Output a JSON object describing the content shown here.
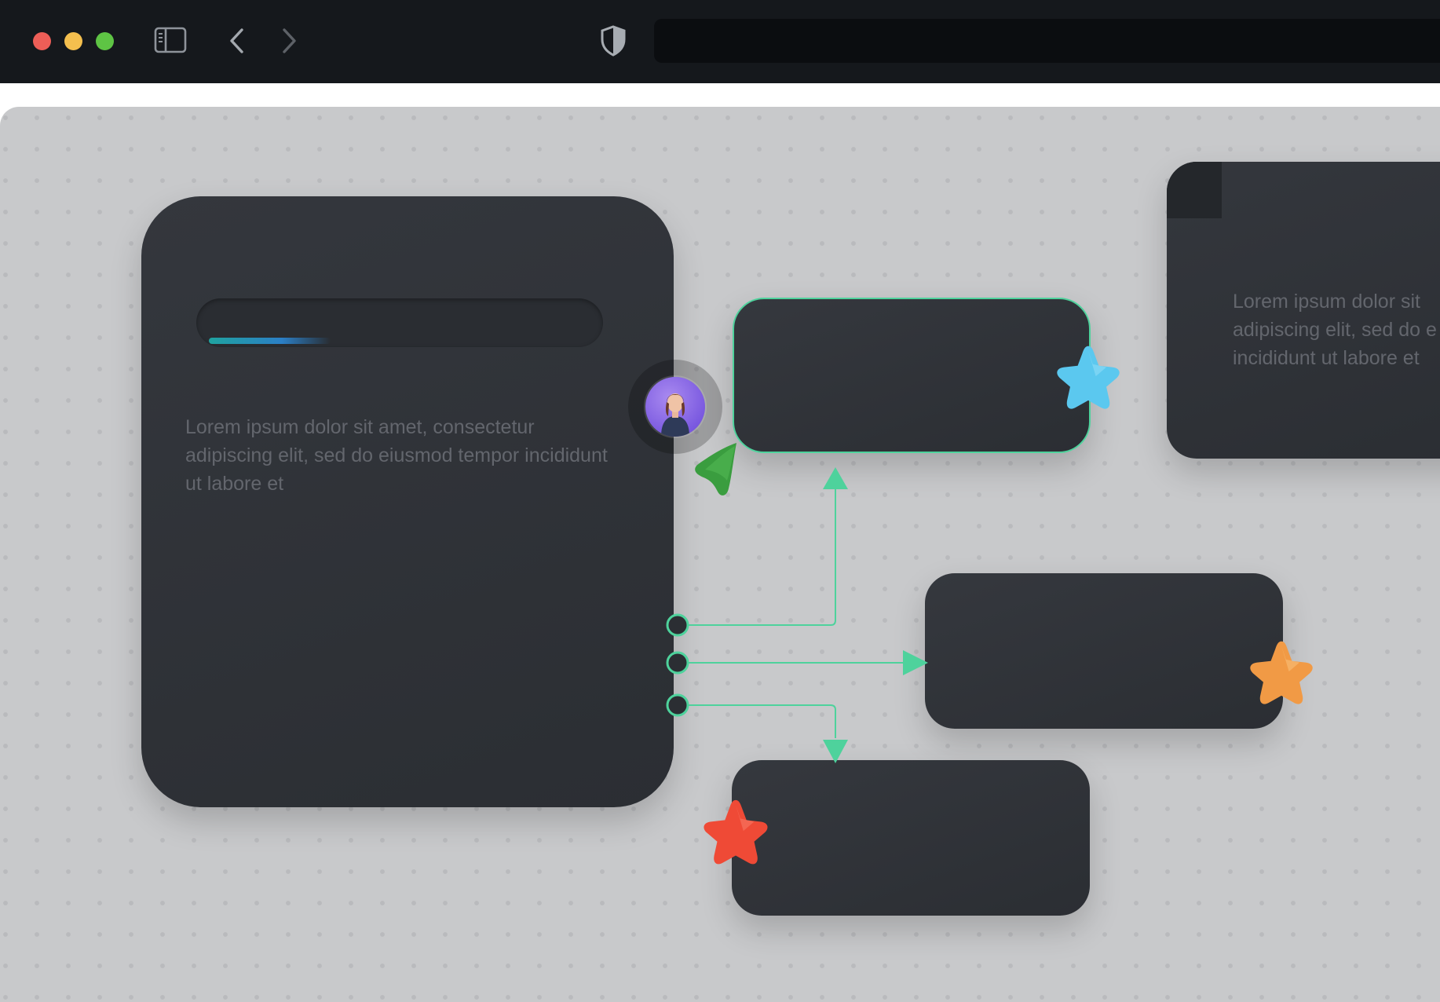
{
  "window": {
    "controls": [
      "close",
      "minimize",
      "maximize"
    ],
    "icons": {
      "sidebar_toggle": "sidebar-icon",
      "back": "chevron-left-icon",
      "forward": "chevron-right-icon",
      "privacy": "shield-icon"
    },
    "address_bar": {
      "value": ""
    }
  },
  "canvas": {
    "main_card": {
      "search_value": "",
      "progress": 0.3,
      "text": "Lorem ipsum dolor sit amet, consectetur adipiscing elit, sed do eiusmod tempor incididunt ut labore et"
    },
    "side_card": {
      "text_lines": [
        "Lorem ipsum dolor sit",
        "adipiscing elit, sed do e",
        "incididunt ut labore et"
      ]
    },
    "avatar": {
      "icon": "user-avatar"
    },
    "stars": [
      {
        "name": "blue-star-icon",
        "color": "#5bc8ef"
      },
      {
        "name": "orange-star-icon",
        "color": "#f19a45"
      },
      {
        "name": "red-star-icon",
        "color": "#ef4a36"
      }
    ],
    "colors": {
      "accent": "#4ed29c",
      "cursor": "#3a9d3f",
      "card": "#2f3237",
      "canvas_bg": "#c8c9cb"
    }
  }
}
